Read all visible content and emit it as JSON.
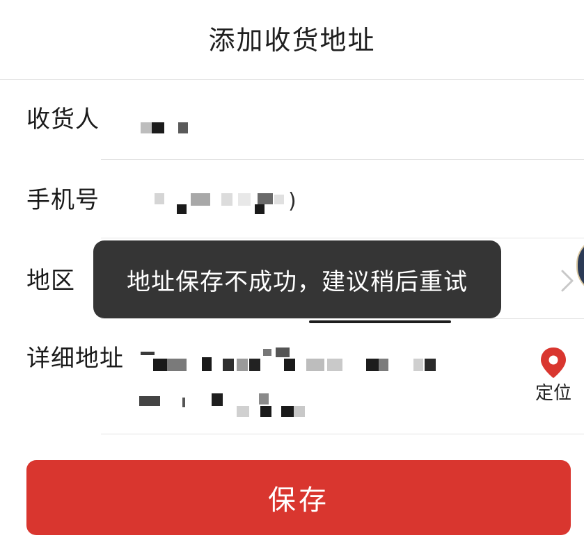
{
  "header": {
    "title": "添加收货地址"
  },
  "form": {
    "recipient": {
      "label": "收货人"
    },
    "phone": {
      "label": "手机号",
      "trailing_char": ")"
    },
    "region": {
      "label": "地区"
    },
    "detail_address": {
      "label": "详细地址"
    },
    "locate": {
      "label": "定位",
      "icon": "location-pin-icon",
      "color": "#d9362f"
    }
  },
  "save_button": {
    "label": "保存",
    "color": "#d9362f"
  },
  "toast": {
    "text": "地址保存不成功，建议稍后重试"
  }
}
